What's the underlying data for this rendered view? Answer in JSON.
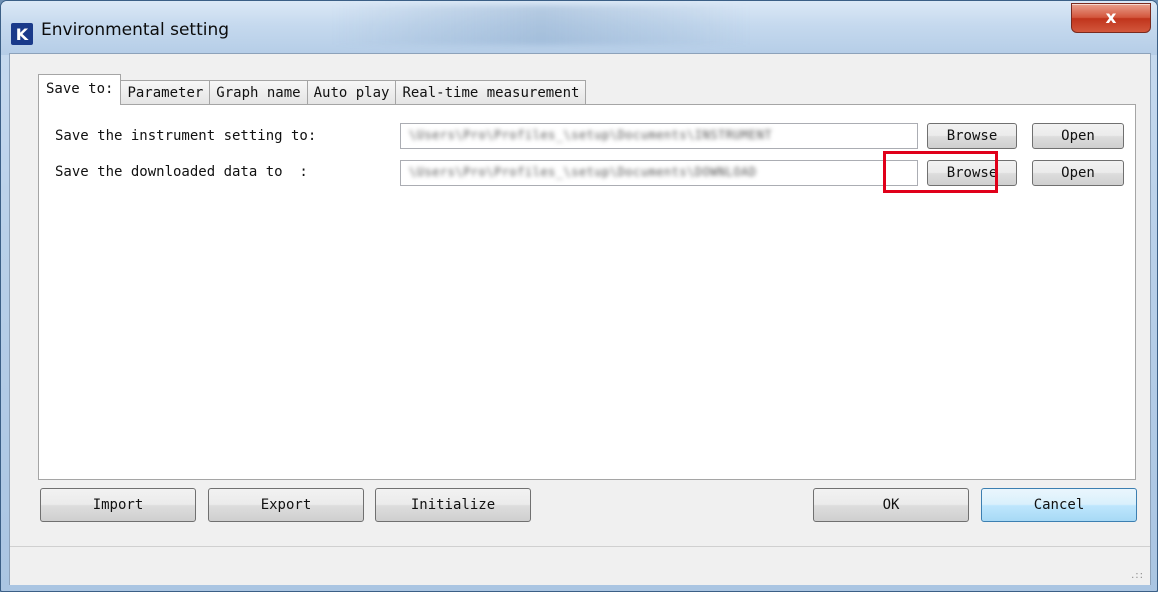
{
  "window": {
    "title": "Environmental setting",
    "close_label": "x",
    "icon": "app-k-logo-icon",
    "icon_glyph": "K"
  },
  "tabs": [
    {
      "label": "Save to:",
      "active": true
    },
    {
      "label": "Parameter",
      "active": false
    },
    {
      "label": "Graph name",
      "active": false
    },
    {
      "label": "Auto play",
      "active": false
    },
    {
      "label": "Real-time measurement",
      "active": false
    }
  ],
  "save_to": {
    "instrument_label": "Save the instrument setting to:",
    "downloaded_label": "Save the downloaded data to  :",
    "instrument_path": "\\Users\\Pro\\Profiles_\\setup\\Documents\\INSTRUMENT",
    "downloaded_path": "\\Users\\Pro\\Profiles_\\setup\\Documents\\DOWNLOAD",
    "browse_label": "Browse",
    "open_label": "Open"
  },
  "footer": {
    "import_label": "Import",
    "export_label": "Export",
    "initialize_label": "Initialize",
    "ok_label": "OK",
    "cancel_label": "Cancel"
  },
  "colors": {
    "highlight": "#e0001a",
    "close_button": "#c0341c"
  }
}
